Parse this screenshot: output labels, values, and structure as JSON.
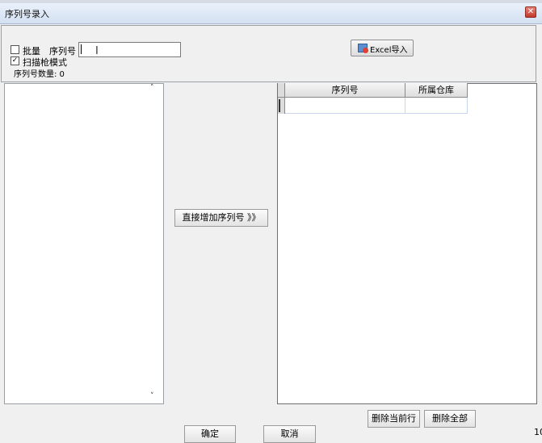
{
  "window": {
    "title": "序列号录入",
    "close_glyph": "✕"
  },
  "top_panel": {
    "batch_checkbox": {
      "label": "批量",
      "checked": false
    },
    "serial_label": "序列号",
    "serial_input_value": "",
    "scan_mode_checkbox": {
      "label": "扫描枪模式",
      "checked": true
    },
    "serial_count_label": "序列号数量: 0",
    "excel_import_label": "Excel导入"
  },
  "left_list": {
    "items": [],
    "scroll_up_glyph": "˄",
    "scroll_down_glyph": "˅"
  },
  "add_button_label": "直接增加序列号 》》",
  "grid": {
    "columns": [
      "序列号",
      "所属仓库"
    ],
    "rows": [
      [
        "",
        ""
      ]
    ]
  },
  "buttons": {
    "delete_current_row": "删除当前行",
    "delete_all": "删除全部",
    "ok": "确定",
    "cancel": "取消"
  },
  "corner_text": "10",
  "icons": {
    "close": "close-icon",
    "excel": "excel-icon",
    "checkbox_check": "✓"
  }
}
